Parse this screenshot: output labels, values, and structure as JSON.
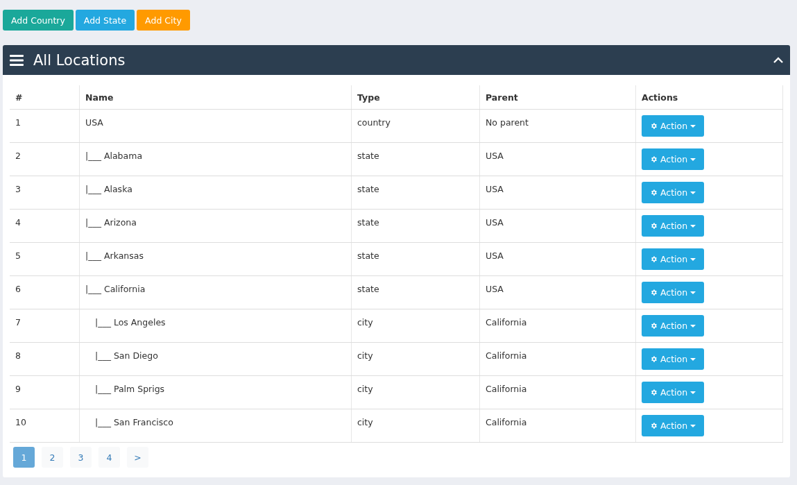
{
  "toolbar": [
    {
      "label": "Add Country",
      "color": "#1aa89a"
    },
    {
      "label": "Add State",
      "color": "#23a8e0"
    },
    {
      "label": "Add City",
      "color": "#ff9a00"
    }
  ],
  "panel": {
    "title": "All Locations",
    "collapsed": false
  },
  "table": {
    "columns": [
      "#",
      "Name",
      "Type",
      "Parent",
      "Actions"
    ],
    "rows": [
      {
        "index": "1",
        "name": "USA",
        "kind": "top",
        "type": "country",
        "parent": "No parent",
        "action": "Action"
      },
      {
        "index": "2",
        "name": "|___ Alabama",
        "kind": "sub",
        "type": "state",
        "parent": "USA",
        "action": "Action"
      },
      {
        "index": "3",
        "name": "|___ Alaska",
        "kind": "sub",
        "type": "state",
        "parent": "USA",
        "action": "Action"
      },
      {
        "index": "4",
        "name": "|___ Arizona",
        "kind": "sub",
        "type": "state",
        "parent": "USA",
        "action": "Action"
      },
      {
        "index": "5",
        "name": "|___ Arkansas",
        "kind": "sub",
        "type": "state",
        "parent": "USA",
        "action": "Action"
      },
      {
        "index": "6",
        "name": "|___ California",
        "kind": "sub",
        "type": "state",
        "parent": "USA",
        "action": "Action"
      },
      {
        "index": "7",
        "name": "|___ Los Angeles",
        "kind": "subsub",
        "type": "city",
        "parent": "California",
        "action": "Action"
      },
      {
        "index": "8",
        "name": "|___ San Diego",
        "kind": "subsub",
        "type": "city",
        "parent": "California",
        "action": "Action"
      },
      {
        "index": "9",
        "name": "|___ Palm Sprigs",
        "kind": "subsub",
        "type": "city",
        "parent": "California",
        "action": "Action"
      },
      {
        "index": "10",
        "name": "|___ San Francisco",
        "kind": "subsub",
        "type": "city",
        "parent": "California",
        "action": "Action"
      }
    ]
  },
  "pagination": [
    {
      "label": "1",
      "selected": true
    },
    {
      "label": "2",
      "selected": false
    },
    {
      "label": "3",
      "selected": false
    },
    {
      "label": "4",
      "selected": false
    },
    {
      "label": ">",
      "selected": false
    }
  ]
}
